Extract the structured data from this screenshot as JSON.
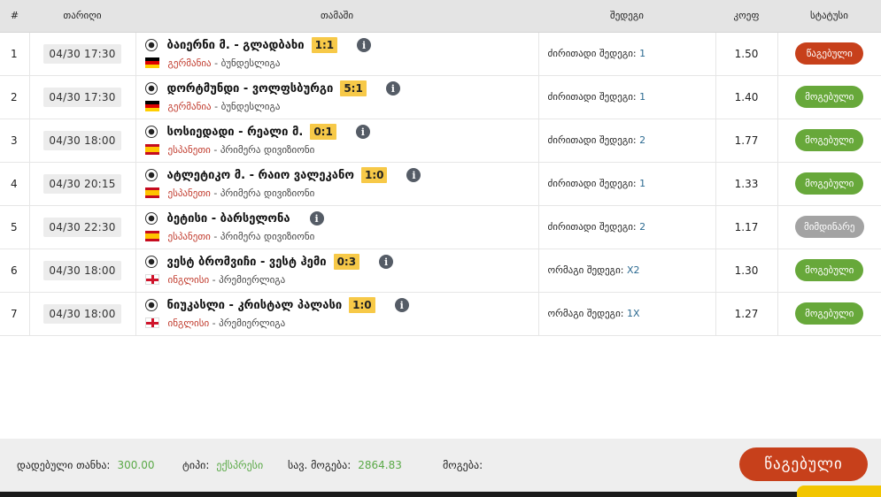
{
  "headers": {
    "num": "#",
    "date": "თარიღი",
    "game": "თამაში",
    "outcome": "შედეგი",
    "odds": "კოეფ",
    "status": "სტატუსი"
  },
  "rows": [
    {
      "num": "1",
      "date": "04/30 17:30",
      "match": "ბაიერნი მ. - გლადბახი",
      "score": "1:1",
      "flag": "de",
      "country": "გერმანია",
      "league": "ბუნდესლიგა",
      "outcome_label": "ძირითადი შედეგი:",
      "outcome_value": "1",
      "odds": "1.50",
      "status": "წაგებული",
      "status_color": "#c7401b"
    },
    {
      "num": "2",
      "date": "04/30 17:30",
      "match": "დორტმუნდი - ვოლფსბურგი",
      "score": "5:1",
      "flag": "de",
      "country": "გერმანია",
      "league": "ბუნდესლიგა",
      "outcome_label": "ძირითადი შედეგი:",
      "outcome_value": "1",
      "odds": "1.40",
      "status": "მოგებული",
      "status_color": "#67a83a"
    },
    {
      "num": "3",
      "date": "04/30 18:00",
      "match": "სოსიედადი - რეალი მ.",
      "score": "0:1",
      "flag": "es",
      "country": "ესპანეთი",
      "league": "პრიმერა დივიზიონი",
      "outcome_label": "ძირითადი შედეგი:",
      "outcome_value": "2",
      "odds": "1.77",
      "status": "მოგებული",
      "status_color": "#67a83a"
    },
    {
      "num": "4",
      "date": "04/30 20:15",
      "match": "ატლეტიკო მ. - რაიო ვალეკანო",
      "score": "1:0",
      "flag": "es",
      "country": "ესპანეთი",
      "league": "პრიმერა დივიზიონი",
      "outcome_label": "ძირითადი შედეგი:",
      "outcome_value": "1",
      "odds": "1.33",
      "status": "მოგებული",
      "status_color": "#67a83a"
    },
    {
      "num": "5",
      "date": "04/30 22:30",
      "match": "ბეტისი - ბარსელონა",
      "score": "",
      "flag": "es",
      "country": "ესპანეთი",
      "league": "პრიმერა დივიზიონი",
      "outcome_label": "ძირითადი შედეგი:",
      "outcome_value": "2",
      "odds": "1.17",
      "status": "მიმდინარე",
      "status_color": "#a3a3a3"
    },
    {
      "num": "6",
      "date": "04/30 18:00",
      "match": "ვესტ ბრომვიჩი - ვესტ ჰემი",
      "score": "0:3",
      "flag": "en",
      "country": "ინგლისი",
      "league": "პრემიერლიგა",
      "outcome_label": "ორმაგი შედეგი:",
      "outcome_value": "X2",
      "odds": "1.30",
      "status": "მოგებული",
      "status_color": "#67a83a"
    },
    {
      "num": "7",
      "date": "04/30 18:00",
      "match": "ნიუკასლი - კრისტალ პალასი",
      "score": "1:0",
      "flag": "en",
      "country": "ინგლისი",
      "league": "პრემიერლიგა",
      "outcome_label": "ორმაგი შედეგი:",
      "outcome_value": "1X",
      "odds": "1.27",
      "status": "მოგებული",
      "status_color": "#67a83a"
    }
  ],
  "footer": {
    "stake_label": "დადებული თანხა:",
    "stake_value": "300.00",
    "type_label": "ტიპი:",
    "type_value": "ექსპრესი",
    "potential_label": "სავ. მოგება:",
    "potential_value": "2864.83",
    "win_label": "მოგება:",
    "win_value": "",
    "result_badge": "წაგებული",
    "result_color": "#c7401b"
  }
}
